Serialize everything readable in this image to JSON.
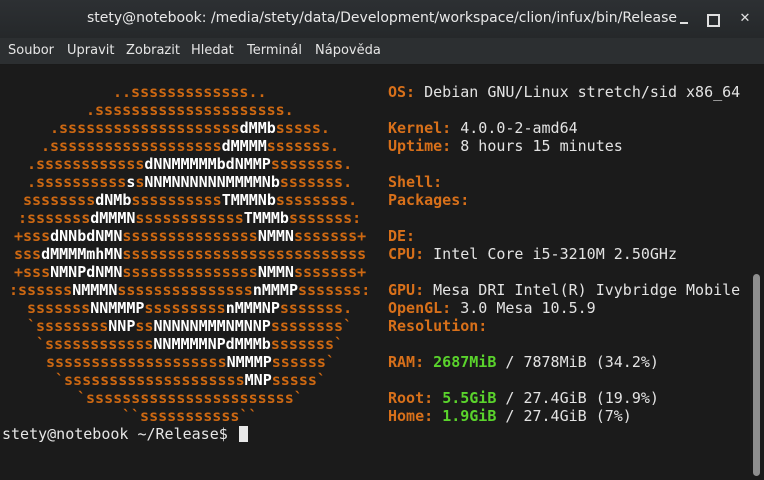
{
  "window": {
    "title": "stety@notebook: /media/stety/data/Development/workspace/clion/infux/bin/Release",
    "minimize_glyph": "",
    "maximize_glyph": "",
    "close_glyph": "✕"
  },
  "menu": [
    "Soubor",
    "Upravit",
    "Zobrazit",
    "Hledat",
    "Terminál",
    "Nápověda"
  ],
  "logo": [
    [
      [
        "o",
        "..sssssssssssss.."
      ]
    ],
    [
      [
        "o",
        ".sssssssssssssssssssss."
      ]
    ],
    [
      [
        "o",
        ".ssssssssssssssssssss"
      ],
      [
        "w",
        "dMMb"
      ],
      [
        "o",
        "sssss."
      ]
    ],
    [
      [
        "o",
        ".sssssssssssssssssss"
      ],
      [
        "w",
        "dMMMM"
      ],
      [
        "o",
        "sssssss."
      ]
    ],
    [
      [
        "o",
        ".ssssssssssss"
      ],
      [
        "w",
        "dNNMMMMMbdNMMP"
      ],
      [
        "o",
        "ssssssss."
      ]
    ],
    [
      [
        "o",
        ".ssssssssss"
      ],
      [
        "w",
        "s"
      ],
      [
        "o",
        "s"
      ],
      [
        "w",
        "NNMNNNNNNMMMMNb"
      ],
      [
        "o",
        "sssssss."
      ]
    ],
    [
      [
        "o",
        "ssssssss"
      ],
      [
        "w",
        "dNMb"
      ],
      [
        "o",
        "ssssssssss"
      ],
      [
        "w",
        "TMMMNb"
      ],
      [
        "o",
        "ssssssss."
      ]
    ],
    [
      [
        "o",
        ":sssssss"
      ],
      [
        "w",
        "dMMMN"
      ],
      [
        "o",
        "ssssssssssss"
      ],
      [
        "w",
        "TMMMb"
      ],
      [
        "o",
        "sssssss:"
      ]
    ],
    [
      [
        "o",
        "+sss"
      ],
      [
        "w",
        "dNNbdNMN"
      ],
      [
        "o",
        "sssssssssssssss"
      ],
      [
        "w",
        "NMMN"
      ],
      [
        "o",
        "sssssss+"
      ]
    ],
    [
      [
        "o",
        "sss"
      ],
      [
        "w",
        "dMMMMmhMN"
      ],
      [
        "o",
        "sssssssssssssssssssssssssss"
      ]
    ],
    [
      [
        "o",
        "+sss"
      ],
      [
        "w",
        "NMNPdNMN"
      ],
      [
        "o",
        "sssssssssssssss"
      ],
      [
        "w",
        "NMMN"
      ],
      [
        "o",
        "sssssss+"
      ]
    ],
    [
      [
        "o",
        ":ssssss"
      ],
      [
        "w",
        "NMMMN"
      ],
      [
        "o",
        "sssssssssssssss"
      ],
      [
        "w",
        "nMMMP"
      ],
      [
        "o",
        "sssssss:"
      ]
    ],
    [
      [
        "o",
        "sssssss"
      ],
      [
        "w",
        "NNMMMP"
      ],
      [
        "o",
        "sssssssss"
      ],
      [
        "w",
        "nMMMNP"
      ],
      [
        "o",
        "sssssss."
      ]
    ],
    [
      [
        "o",
        "`ssssssss"
      ],
      [
        "w",
        "NNP"
      ],
      [
        "o",
        "ss"
      ],
      [
        "w",
        "NNNNNMMMNMNNP"
      ],
      [
        "o",
        "ssssssss`"
      ]
    ],
    [
      [
        "o",
        "`ssssssssssss"
      ],
      [
        "w",
        "NNMMMMNPdMMMb"
      ],
      [
        "o",
        "sssssss`"
      ]
    ],
    [
      [
        "o",
        "ssssssssssssssssssss"
      ],
      [
        "w",
        "NMMMP"
      ],
      [
        "o",
        "ssssss`"
      ]
    ],
    [
      [
        "o",
        "`ssssssssssssssssssss"
      ],
      [
        "w",
        "MNP"
      ],
      [
        "o",
        "sssss`"
      ]
    ],
    [
      [
        "o",
        "`sssssssssssssssssssssss`"
      ]
    ],
    [
      [
        "o",
        "``sssssssssss``"
      ]
    ]
  ],
  "info": {
    "os": {
      "label": "OS:",
      "value": "Debian GNU/Linux stretch/sid x86_64"
    },
    "kernel": {
      "label": "Kernel:",
      "value": "4.0.0-2-amd64"
    },
    "uptime": {
      "label": "Uptime:",
      "value": "8 hours 15 minutes"
    },
    "shell": {
      "label": "Shell:",
      "value": ""
    },
    "packages": {
      "label": "Packages:",
      "value": ""
    },
    "de": {
      "label": "DE:",
      "value": ""
    },
    "cpu": {
      "label": "CPU:",
      "value": "Intel Core i5-3210M 2.50GHz"
    },
    "gpu": {
      "label": "GPU:",
      "value": "Mesa DRI Intel(R) Ivybridge Mobile"
    },
    "opengl": {
      "label": "OpenGL:",
      "value": "3.0 Mesa 10.5.9"
    },
    "resolution": {
      "label": "Resolution:",
      "value": ""
    },
    "ram": {
      "label": "RAM:",
      "used": "2687MiB",
      "rest": "/ 7878MiB (34.2%)"
    },
    "root": {
      "label": "Root:",
      "used": "5.5GiB",
      "rest": "/ 27.4GiB (19.9%)"
    },
    "home": {
      "label": "Home:",
      "used": "1.9GiB",
      "rest": "/ 27.4GiB (7%)"
    }
  },
  "prompt": "stety@notebook ~/Release$"
}
